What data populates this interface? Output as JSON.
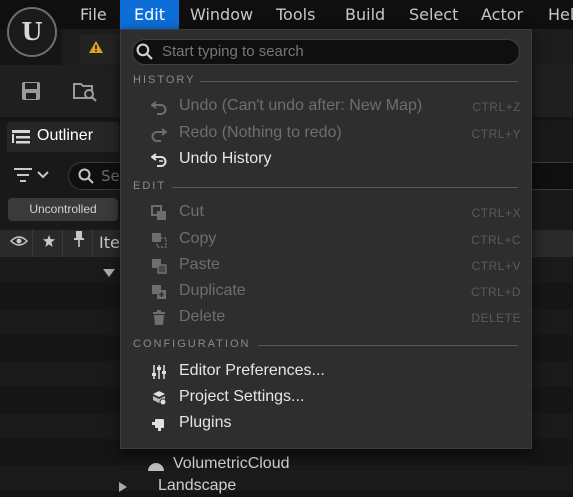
{
  "menubar": {
    "items": [
      "File",
      "Edit",
      "Window",
      "Tools",
      "Build",
      "Select",
      "Actor",
      "Help"
    ],
    "active": "Edit"
  },
  "logo": {
    "glyph": "U"
  },
  "outliner": {
    "title": "Outliner",
    "search_placeholder": "Se",
    "uncontrolled": "Uncontrolled",
    "header_label": "Iten",
    "items": [
      "VolumetricCloud",
      "Landscape"
    ]
  },
  "edit_menu": {
    "search_placeholder": "Start typing to search",
    "sections": [
      {
        "title": "HISTORY",
        "items": [
          {
            "label": "Undo (Can't undo after: New Map)",
            "shortcut": "CTRL+Z",
            "enabled": false,
            "icon": "undo-icon"
          },
          {
            "label": "Redo (Nothing to redo)",
            "shortcut": "CTRL+Y",
            "enabled": false,
            "icon": "redo-icon"
          },
          {
            "label": "Undo History",
            "shortcut": "",
            "enabled": true,
            "icon": "undo-history-icon"
          }
        ]
      },
      {
        "title": "EDIT",
        "items": [
          {
            "label": "Cut",
            "shortcut": "CTRL+X",
            "enabled": false,
            "icon": "cut-icon"
          },
          {
            "label": "Copy",
            "shortcut": "CTRL+C",
            "enabled": false,
            "icon": "copy-icon"
          },
          {
            "label": "Paste",
            "shortcut": "CTRL+V",
            "enabled": false,
            "icon": "paste-icon"
          },
          {
            "label": "Duplicate",
            "shortcut": "CTRL+D",
            "enabled": false,
            "icon": "duplicate-icon"
          },
          {
            "label": "Delete",
            "shortcut": "DELETE",
            "enabled": false,
            "icon": "trash-icon"
          }
        ]
      },
      {
        "title": "CONFIGURATION",
        "items": [
          {
            "label": "Editor Preferences...",
            "shortcut": "",
            "enabled": true,
            "icon": "sliders-icon"
          },
          {
            "label": "Project Settings...",
            "shortcut": "",
            "enabled": true,
            "icon": "project-settings-icon"
          },
          {
            "label": "Plugins",
            "shortcut": "",
            "enabled": true,
            "icon": "plugin-icon"
          }
        ]
      }
    ]
  },
  "colors": {
    "accent": "#0d6ed8",
    "menu_bg": "#2e2e2e",
    "disabled": "#6e6e6e"
  }
}
